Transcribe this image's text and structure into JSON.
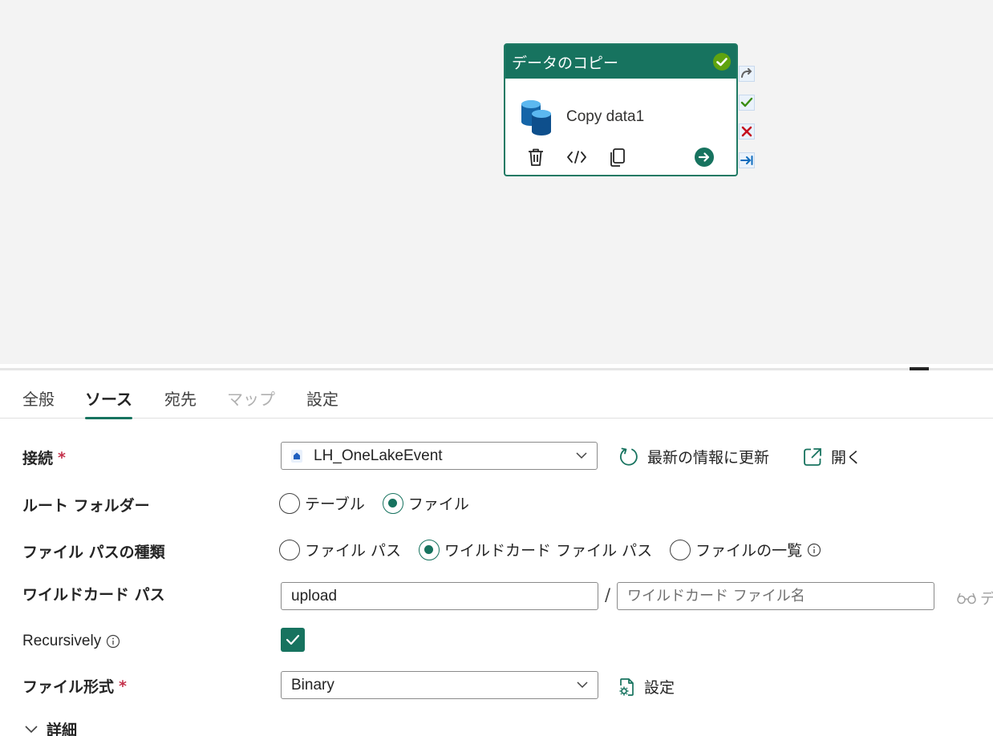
{
  "activity": {
    "type_title": "データのコピー",
    "name": "Copy data1"
  },
  "tabs": [
    {
      "label": "全般"
    },
    {
      "label": "ソース"
    },
    {
      "label": "宛先"
    },
    {
      "label": "マップ"
    },
    {
      "label": "設定"
    }
  ],
  "source": {
    "connection": {
      "label": "接続",
      "required_mark": "*",
      "value": "LH_OneLakeEvent",
      "refresh_label": "最新の情報に更新",
      "open_label": "開く"
    },
    "root_folder": {
      "label": "ルート フォルダー",
      "options": [
        "テーブル",
        "ファイル"
      ],
      "selected": "ファイル"
    },
    "file_path_type": {
      "label": "ファイル パスの種類",
      "options": [
        "ファイル パス",
        "ワイルドカード ファイル パス",
        "ファイルの一覧"
      ],
      "selected": "ワイルドカード ファイル パス"
    },
    "wildcard_path": {
      "label": "ワイルドカード パス",
      "folder_value": "upload",
      "separator": "/",
      "file_placeholder": "ワイルドカード ファイル名",
      "preview_truncated": "デ"
    },
    "recursively": {
      "label": "Recursively",
      "checked": true
    },
    "file_format": {
      "label": "ファイル形式",
      "required_mark": "*",
      "value": "Binary",
      "settings_label": "設定"
    },
    "advanced": {
      "label": "詳細"
    }
  },
  "colors": {
    "accent": "#17735f",
    "canvas_bg": "#f3f3f3",
    "required": "#c4314b",
    "success": "#5fa30f",
    "fail": "#c50f1f",
    "link_blue": "#0f6cbd"
  },
  "icons": [
    "check-circle-icon",
    "database-icon",
    "delete-icon",
    "code-icon",
    "copy-icon",
    "arrow-right-circle-icon",
    "skip-port-icon",
    "success-port-icon",
    "fail-port-icon",
    "completion-port-icon",
    "lakehouse-icon",
    "chevron-down-icon",
    "refresh-icon",
    "open-external-icon",
    "info-icon",
    "checkmark-icon",
    "preview-icon",
    "settings-file-icon"
  ]
}
